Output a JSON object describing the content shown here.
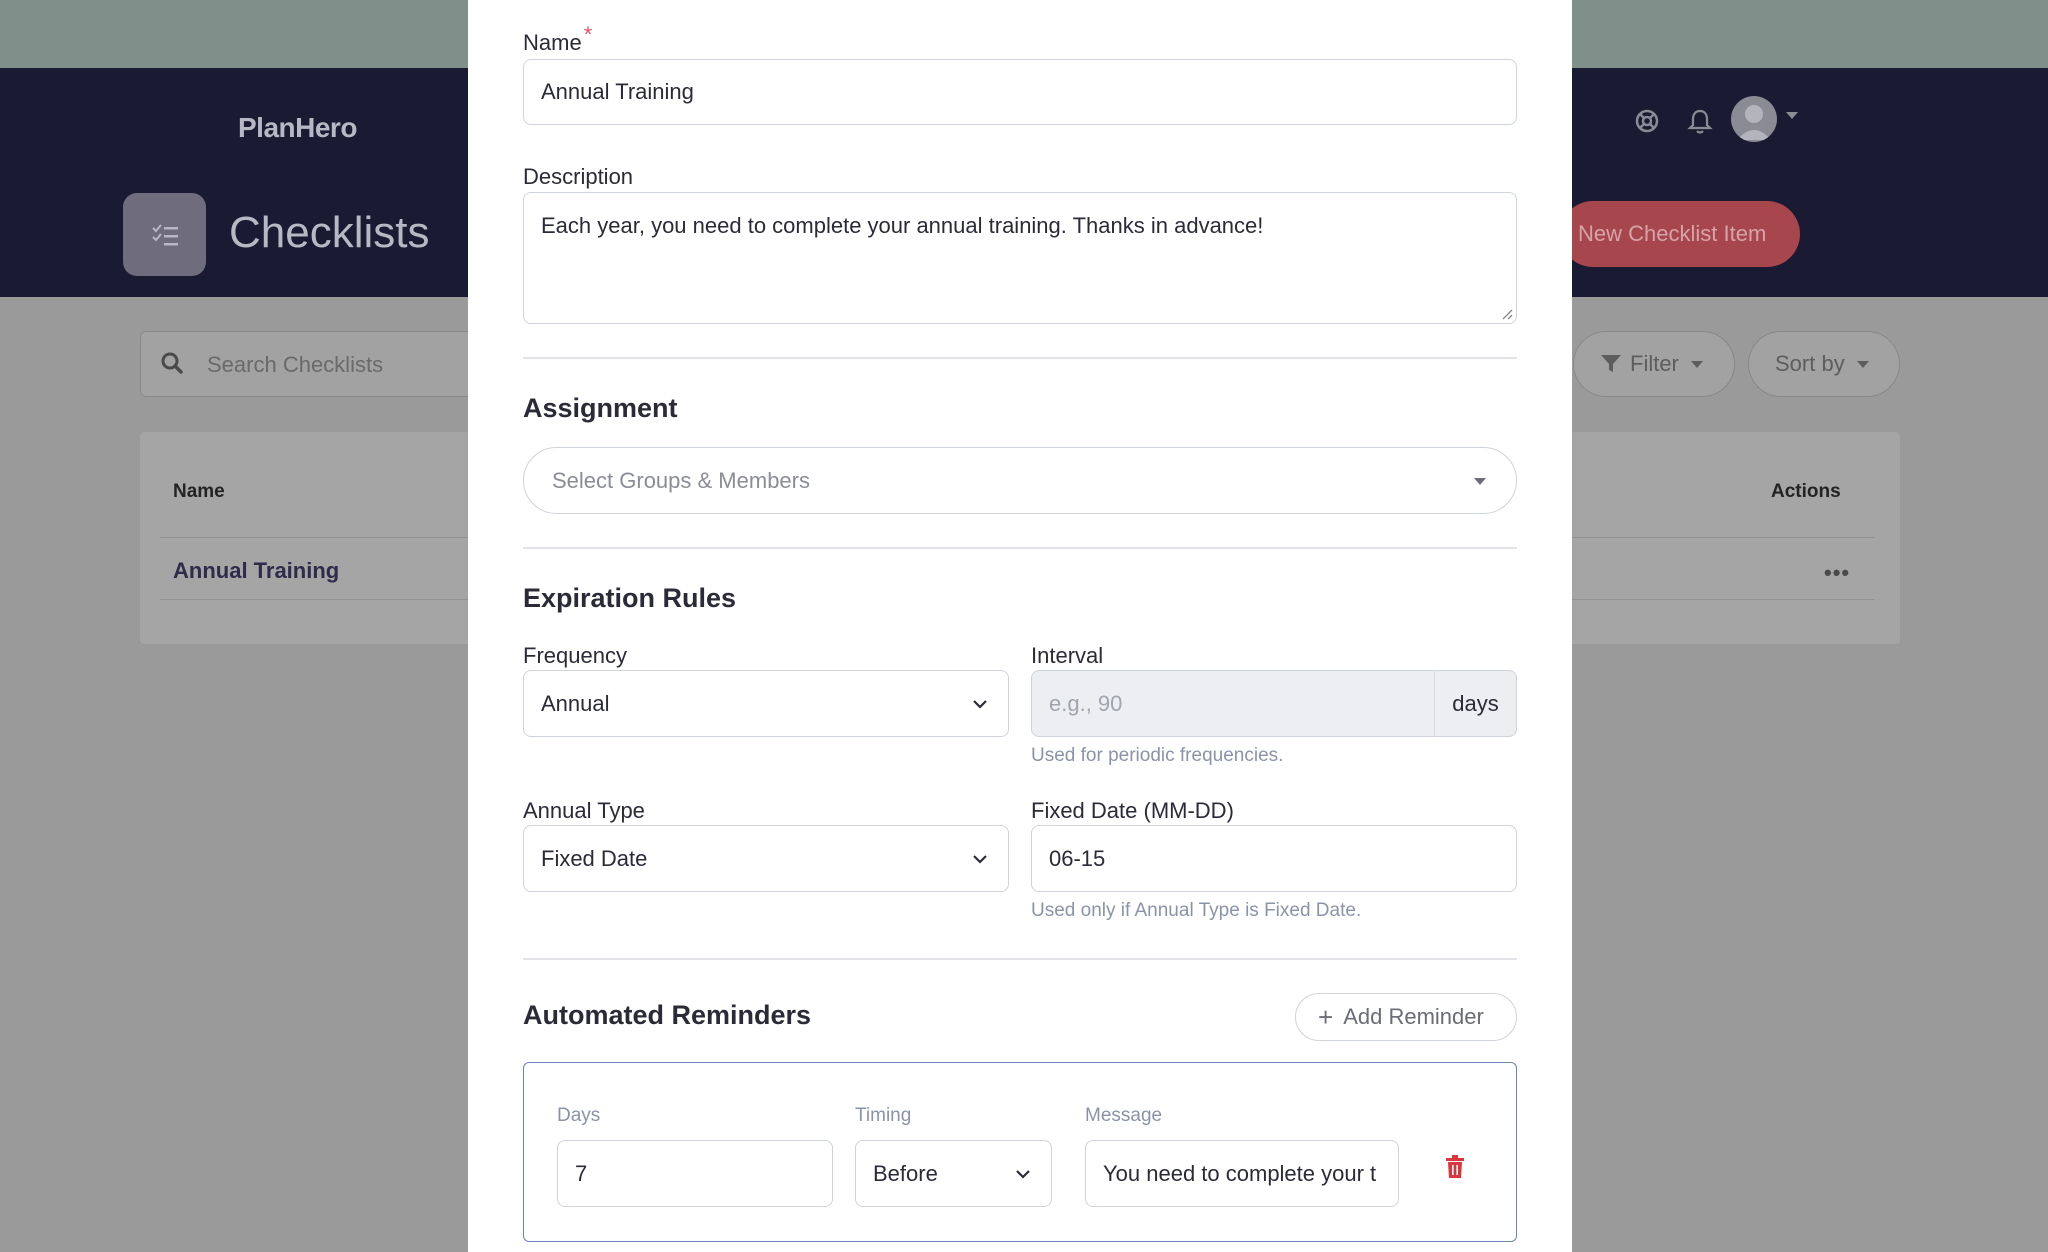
{
  "app": {
    "brand": "PlanHero",
    "page_title": "Checklists",
    "new_button": "New Checklist Item"
  },
  "toolbar": {
    "search_placeholder": "Search Checklists",
    "filter_label": "Filter",
    "sort_label": "Sort by"
  },
  "table": {
    "headers": {
      "name": "Name",
      "actions": "Actions"
    },
    "rows": [
      {
        "name": "Annual Training",
        "actions": "•••"
      }
    ]
  },
  "modal": {
    "name": {
      "label": "Name",
      "required_mark": "*",
      "value": "Annual Training"
    },
    "description": {
      "label": "Description",
      "value": "Each year, you need to complete your annual training. Thanks in advance!"
    },
    "assignment": {
      "title": "Assignment",
      "placeholder": "Select Groups & Members"
    },
    "expiration": {
      "title": "Expiration Rules",
      "frequency": {
        "label": "Frequency",
        "value": "Annual"
      },
      "interval": {
        "label": "Interval",
        "placeholder": "e.g., 90",
        "addon": "days",
        "help": "Used for periodic frequencies."
      },
      "annual_type": {
        "label": "Annual Type",
        "value": "Fixed Date"
      },
      "fixed_date": {
        "label": "Fixed Date (MM-DD)",
        "value": "06-15",
        "help": "Used only if Annual Type is Fixed Date."
      }
    },
    "reminders": {
      "title": "Automated Reminders",
      "add_button": "Add Reminder",
      "items": [
        {
          "days_label": "Days",
          "days": "7",
          "timing_label": "Timing",
          "timing": "Before",
          "message_label": "Message",
          "message": "You need to complete your t"
        }
      ]
    }
  },
  "colors": {
    "header_bg": "#1b1a33",
    "accent_red": "#e05260",
    "delete_red": "#d9363e",
    "card_border": "#6f86b5"
  }
}
